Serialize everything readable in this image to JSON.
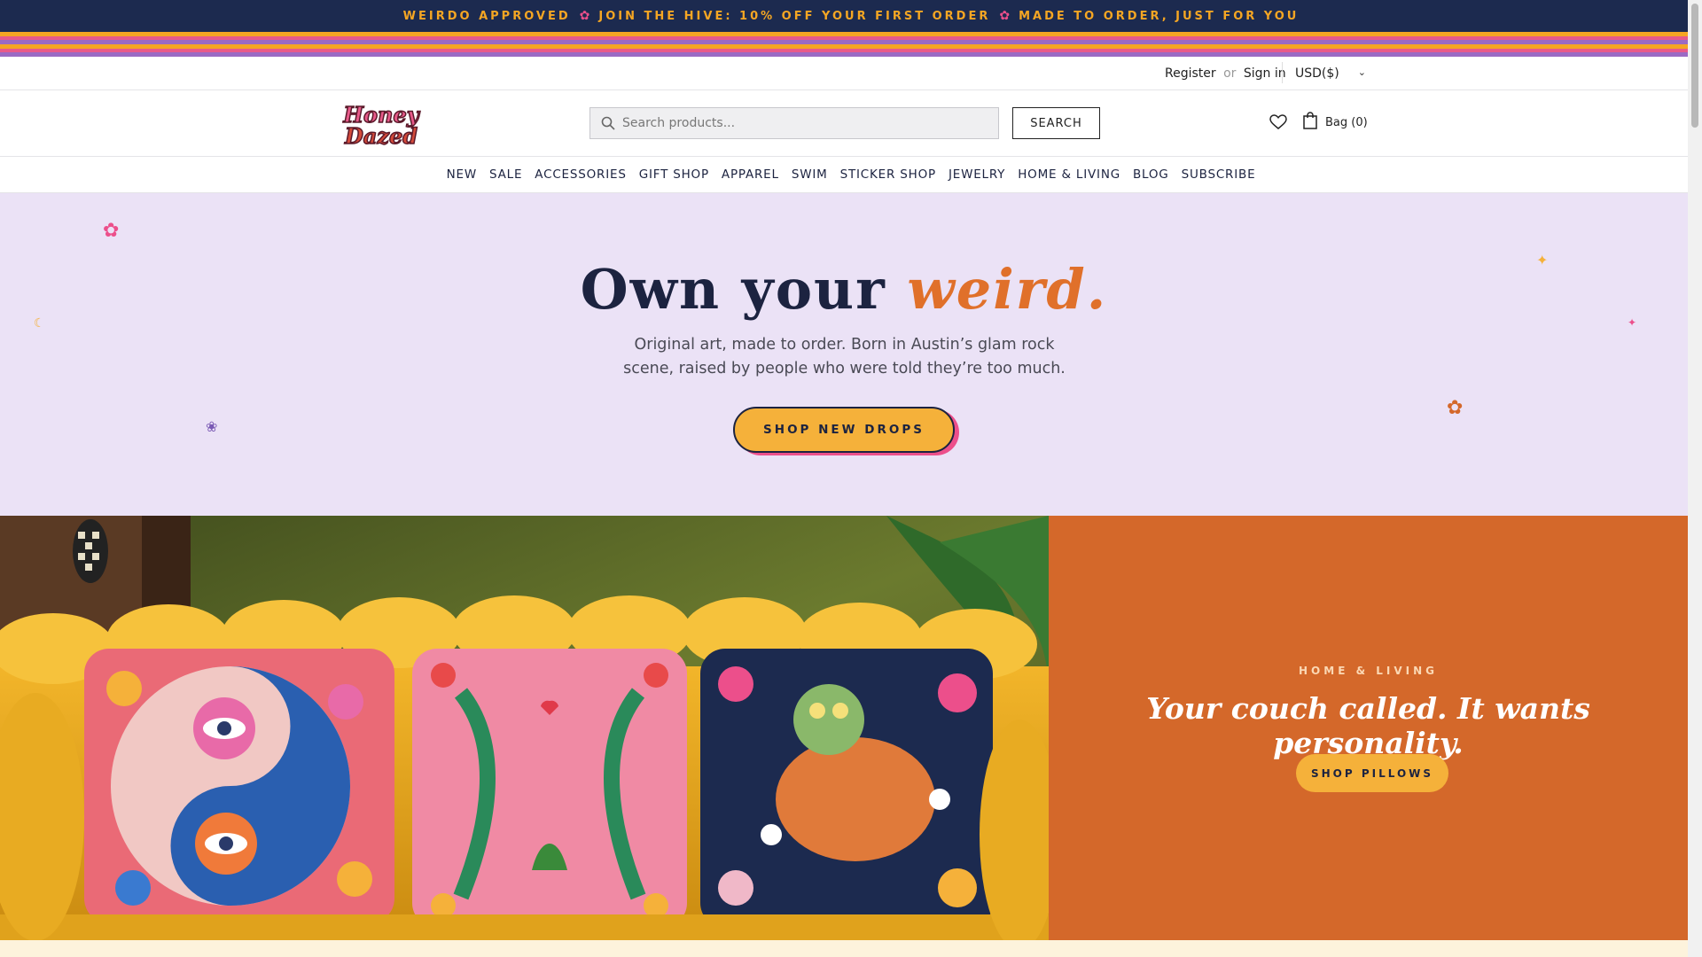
{
  "announcement": {
    "part1": "WEIRDO APPROVED",
    "part2": "JOIN THE HIVE: 10% OFF YOUR FIRST ORDER",
    "part3": "MADE TO ORDER, JUST FOR YOU",
    "separator": "✿"
  },
  "stripe_colors": [
    "#f5a623",
    "#e85a8a",
    "#9b6ac4",
    "#f5a623",
    "#e85a8a",
    "#9b6ac4"
  ],
  "utility": {
    "register": "Register",
    "or": "or",
    "sign_in": "Sign in",
    "currency": "USD($)"
  },
  "header": {
    "logo_text_line1": "Honey",
    "logo_text_line2": "Dazed",
    "search_placeholder": "Search products...",
    "search_button": "SEARCH",
    "bag_label": "Bag (0)"
  },
  "nav": [
    "NEW",
    "SALE",
    "ACCESSORIES",
    "GIFT SHOP",
    "APPAREL",
    "SWIM",
    "STICKER SHOP",
    "JEWELRY",
    "HOME & LIVING",
    "BLOG",
    "SUBSCRIBE"
  ],
  "hero": {
    "title_plain": "Own your ",
    "title_accent": "weird.",
    "subtitle": "Original art, made to order. Born in Austin’s glam rock scene, raised by people who were told they’re too much.",
    "cta": "SHOP NEW DROPS"
  },
  "feature": {
    "kicker": "HOME & LIVING",
    "headline": "Your couch called. It wants personality.",
    "cta": "SHOP PILLOWS"
  },
  "colors": {
    "navy": "#1c2340",
    "announce_bg": "#1c2a4f",
    "accent_orange": "#e0702a",
    "hero_bg": "#ebe2f6",
    "panel_bg": "#d4682a",
    "button_yellow": "#f5b13a",
    "pink": "#ec4f8b"
  }
}
